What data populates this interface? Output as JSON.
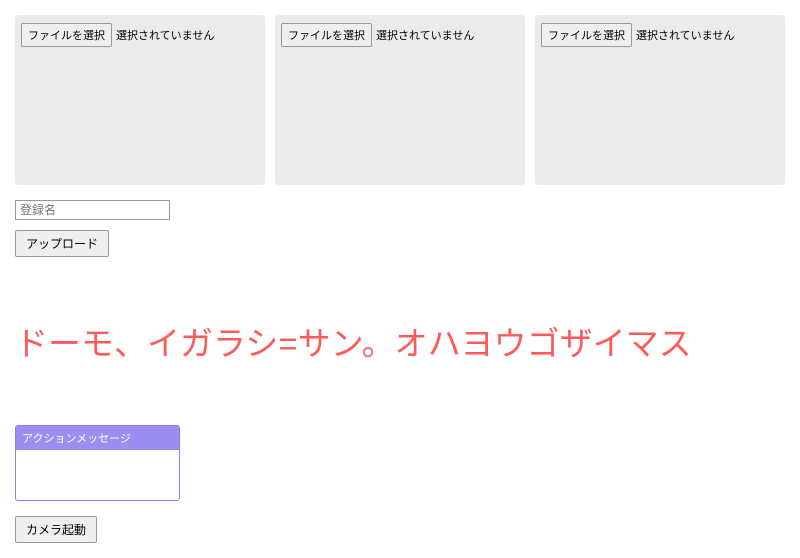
{
  "upload_boxes": [
    {
      "button_label": "ファイルを選択",
      "status": "選択されていません"
    },
    {
      "button_label": "ファイルを選択",
      "status": "選択されていません"
    },
    {
      "button_label": "ファイルを選択",
      "status": "選択されていません"
    }
  ],
  "register_name": {
    "placeholder": "登録名",
    "value": ""
  },
  "upload_button_label": "アップロード",
  "greeting_text": "ドーモ、イガラシ=サン。オハヨウゴザイマス",
  "action_box": {
    "header": "アクションメッセージ"
  },
  "camera_button_label": "カメラ起動"
}
